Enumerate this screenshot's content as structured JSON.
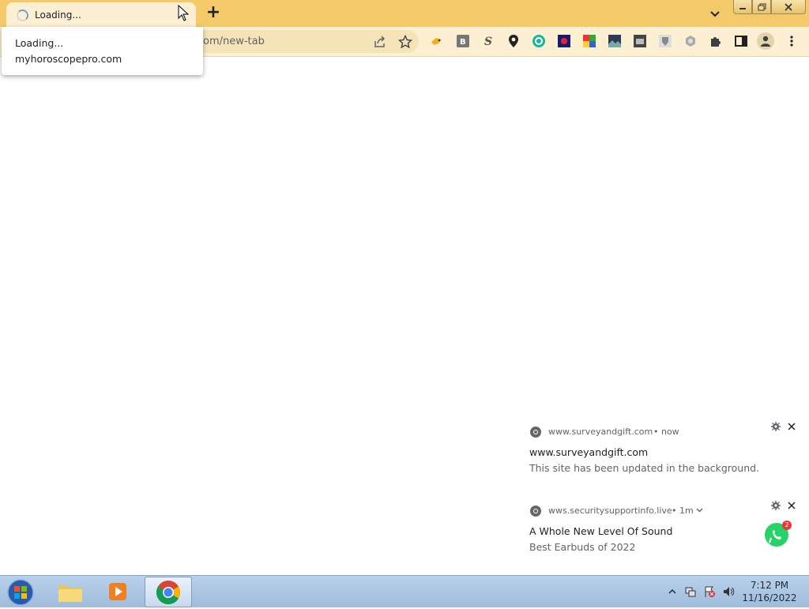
{
  "tab": {
    "title": "Loading..."
  },
  "tab_popup": {
    "line1": "Loading...",
    "line2": "myhoroscopepro.com"
  },
  "omnibox": {
    "url_fragment": "om/new-tab"
  },
  "icons": [
    "spinner",
    "new-tab-plus-icon",
    "tab-list-chevron-icon",
    "minimize-icon",
    "restore-icon",
    "close-icon",
    "share-icon",
    "bookmark-star-icon",
    "extension-icons",
    "puzzle-icon",
    "side-panel-icon",
    "profile-icon",
    "kebab-menu-icon",
    "chrome-icon",
    "gear-icon",
    "whatsapp-icon"
  ],
  "notifications": [
    {
      "origin": "www.surveyandgift.com",
      "time": "• now",
      "title": "www.surveyandgift.com",
      "body": "This site has been updated in the background."
    },
    {
      "origin": "wws.securitysupportinfo.live",
      "time": "• 1m",
      "title": "A Whole New Level Of Sound",
      "body": "Best Earbuds of 2022",
      "badge": "2"
    }
  ],
  "taskbar": {
    "time": "7:12 PM",
    "date": "11/16/2022"
  },
  "colors": {
    "tabstrip": "#f3c969",
    "toolbar": "#fcefd2",
    "taskbar": "#aac5e2"
  }
}
